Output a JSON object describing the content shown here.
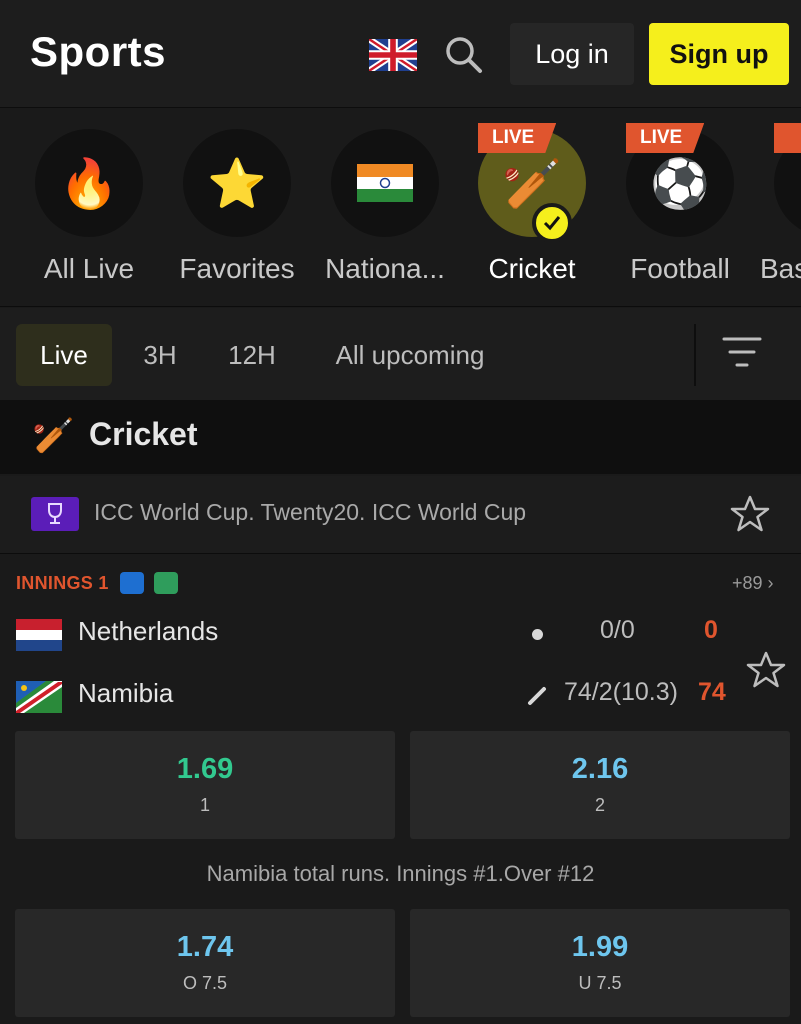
{
  "header": {
    "title": "Sports",
    "login_label": "Log in",
    "signup_label": "Sign up",
    "signup_color": "#f5ef1c",
    "language_icon": "uk-flag-icon",
    "search_icon": "search-icon"
  },
  "categories": [
    {
      "label": "All Live",
      "icon": "fire-icon"
    },
    {
      "label": "Favorites",
      "icon": "star-icon"
    },
    {
      "label": "Nationa...",
      "icon": "india-flag-icon"
    },
    {
      "label": "Cricket",
      "icon": "cricket-icon",
      "badge": "LIVE",
      "selected": true
    },
    {
      "label": "Football",
      "icon": "football-icon",
      "badge": "LIVE"
    },
    {
      "label": "Bas",
      "icon": "basketball-icon"
    }
  ],
  "time_filters": {
    "items": [
      "Live",
      "3H",
      "12H",
      "All upcoming"
    ],
    "active": "Live"
  },
  "section": {
    "title": "Cricket"
  },
  "league": {
    "name": "ICC World Cup. Twenty20. ICC World Cup"
  },
  "match": {
    "status": "INNINGS 1",
    "more_markets": "+89 ›",
    "team1": {
      "name": "Netherlands",
      "detail": "0/0",
      "score": "0"
    },
    "team2": {
      "name": "Namibia",
      "detail": "74/2(10.3)",
      "score": "74"
    },
    "odds": [
      {
        "value": "1.69",
        "label": "1"
      },
      {
        "value": "2.16",
        "label": "2"
      }
    ],
    "market_title": "Namibia total runs. Innings #1.Over #12",
    "market_odds": [
      {
        "value": "1.74",
        "label": "O 7.5"
      },
      {
        "value": "1.99",
        "label": "U 7.5"
      }
    ]
  },
  "colors": {
    "live_badge": "#e0552e",
    "score": "#e0552e",
    "odd_green": "#32c98f",
    "odd_blue": "#6ec6ee"
  }
}
